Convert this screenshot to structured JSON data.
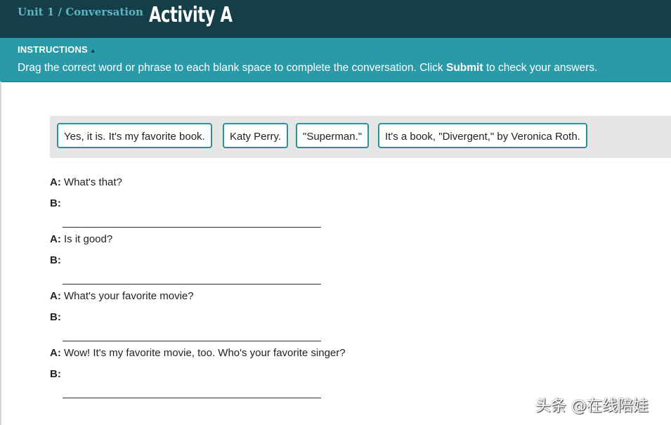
{
  "header": {
    "unit_label": "Unit 1 / Conversation",
    "title": "Activity A"
  },
  "instructions": {
    "label": "INSTRUCTIONS",
    "toggle_icon": "triangle-up-icon",
    "text_before": "Drag the correct word or phrase to each blank space to complete the conversation. Click ",
    "text_bold": "Submit",
    "text_after": " to check your answers."
  },
  "word_bank": [
    "Yes, it is. It's my favorite book.",
    "Katy Perry.",
    "\"Superman.\"",
    "It's a book, \"Divergent,\" by Veronica Roth."
  ],
  "conversation": [
    {
      "a_label": "A:",
      "a_text": " What's that?",
      "b_label": "B:"
    },
    {
      "a_label": "A:",
      "a_text": " Is it good?",
      "b_label": "B:"
    },
    {
      "a_label": "A:",
      "a_text": " What's your favorite movie?",
      "b_label": "B:"
    },
    {
      "a_label": "A:",
      "a_text": " Wow! It's my favorite movie, too. Who's your favorite singer?",
      "b_label": "B:"
    }
  ],
  "watermark": "头条 @在线陪娃",
  "colors": {
    "header_bg": "#143f48",
    "instructions_bg": "#2b9aa8",
    "chip_border": "#2b8f9c",
    "bank_bg": "#e6e6e6"
  }
}
